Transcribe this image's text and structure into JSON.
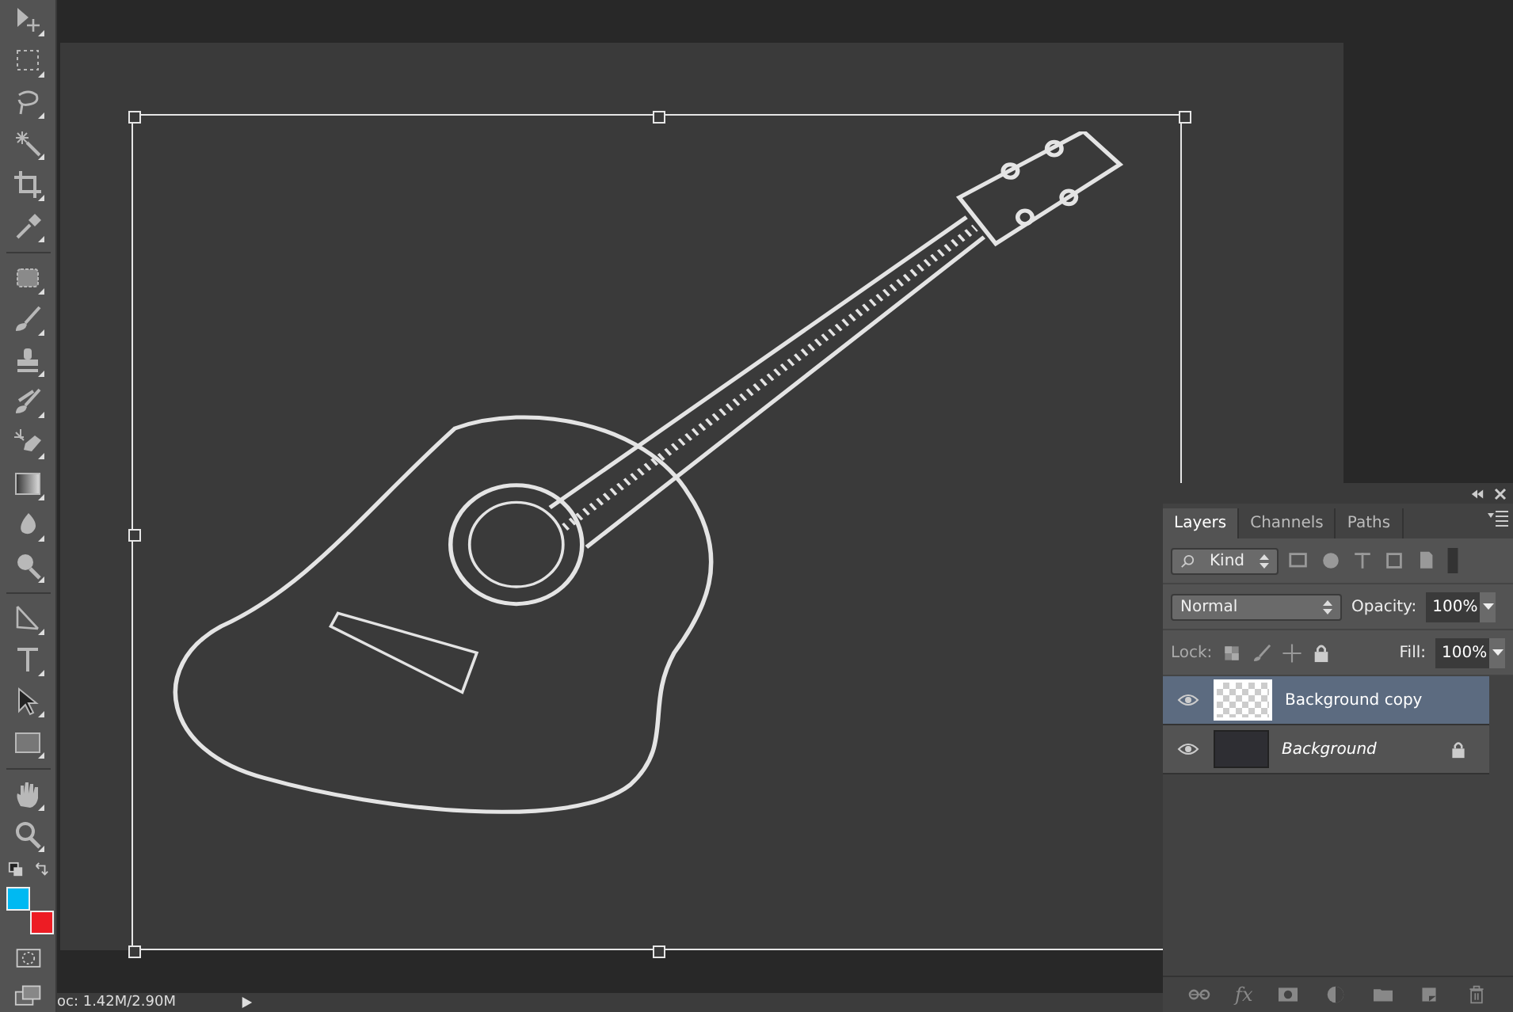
{
  "swatches": [
    {
      "kind": "foreground",
      "color": "#00b9f2"
    },
    {
      "kind": "background",
      "color": "#ed1c24"
    }
  ],
  "layers_panel": {
    "tabs": [
      {
        "label": "Layers",
        "selected": true
      },
      {
        "label": "Channels",
        "selected": false
      },
      {
        "label": "Paths",
        "selected": false
      }
    ],
    "filter": {
      "value": "Kind"
    },
    "blend_mode": "Normal",
    "opacity_label": "Opacity:",
    "opacity": "100%",
    "lock_label": "Lock:",
    "fill_label": "Fill:",
    "fill": "100%",
    "layers": [
      {
        "name": "Background copy",
        "kind": "normal",
        "selected": true,
        "visible": true,
        "locked": false
      },
      {
        "name": "Background",
        "kind": "background",
        "selected": false,
        "visible": true,
        "locked": true
      }
    ],
    "footer_fx": "fx"
  },
  "status_bar": {
    "doc_size": "oc: 1.42M/2.90M"
  }
}
